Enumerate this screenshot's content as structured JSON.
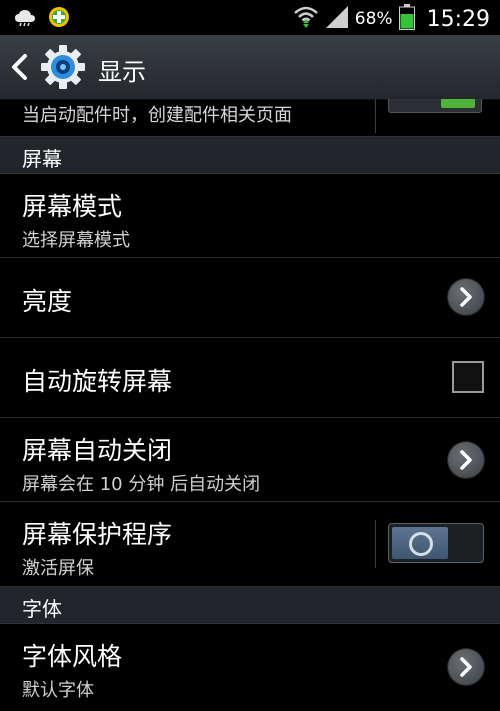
{
  "status_bar": {
    "battery_percent": "68%",
    "time": "15:29",
    "icons": [
      "cloud-icon",
      "app-plus-icon",
      "wifi-icon",
      "signal-icon",
      "battery-icon"
    ]
  },
  "header": {
    "title": "显示"
  },
  "partial_row": {
    "subtitle": "当启动配件时，创建配件相关页面"
  },
  "sections": {
    "screen": "屏幕",
    "font": "字体"
  },
  "rows": {
    "screen_mode": {
      "title": "屏幕模式",
      "subtitle": "选择屏幕模式"
    },
    "brightness": {
      "title": "亮度"
    },
    "auto_rotate": {
      "title": "自动旋转屏幕",
      "checked": false
    },
    "screen_timeout": {
      "title": "屏幕自动关闭",
      "subtitle": "屏幕会在 10 分钟 后自动关闭"
    },
    "screen_saver": {
      "title": "屏幕保护程序",
      "subtitle": "激活屏保",
      "enabled": false
    },
    "font_style": {
      "title": "字体风格",
      "subtitle": "默认字体"
    }
  },
  "colors": {
    "accent_green": "#4fb43a",
    "toggle_blue": "#4f6780"
  }
}
